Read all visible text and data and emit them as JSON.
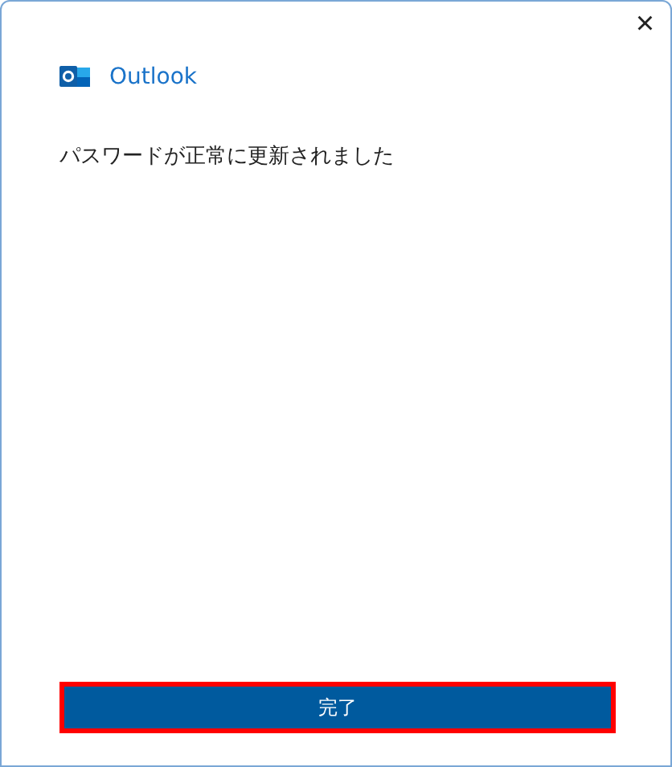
{
  "window": {
    "close_glyph": "×"
  },
  "app": {
    "name": "Outlook"
  },
  "message": "パスワードが正常に更新されました",
  "done_button": {
    "label": "完了",
    "highlighted": true
  }
}
